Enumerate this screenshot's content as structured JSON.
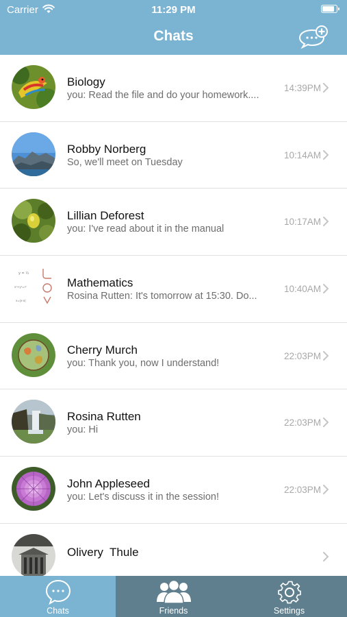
{
  "status_bar": {
    "carrier": "Carrier",
    "time": "11:29 PM",
    "battery_level": 0.9
  },
  "nav": {
    "title": "Chats",
    "new_chat_icon": "chat-plus-icon"
  },
  "chats": [
    {
      "name": "Biology",
      "preview": "you: Read the file and do your homework....",
      "time": "14:39PM",
      "avatar": "parrot-photo"
    },
    {
      "name": "Robby Norberg",
      "preview": "So, we'll meet on Tuesday",
      "time": "10:14AM",
      "avatar": "mountain-lake-photo"
    },
    {
      "name": "Lillian Deforest",
      "preview": "you: I've read about it in the manual",
      "time": "10:17AM",
      "avatar": "lemon-tree-photo"
    },
    {
      "name": "Mathematics",
      "preview": "Rosina Rutten: It's tomorrow at 15:30. Do...",
      "time": "10:40AM",
      "avatar": "math-formulas-image"
    },
    {
      "name": "Cherry Murch",
      "preview": "you: Thank you, now I understand!",
      "time": "22:03PM",
      "avatar": "map-globe-photo"
    },
    {
      "name": "Rosina Rutten",
      "preview": "you: Hi",
      "time": "22:03PM",
      "avatar": "waterfall-photo"
    },
    {
      "name": "John Appleseed",
      "preview": "you: Let's discuss it in the session!",
      "time": "22:03PM",
      "avatar": "dahlia-flower-photo"
    },
    {
      "name": "Olivery  Thule",
      "preview": "",
      "time": "",
      "avatar": "building-photo"
    }
  ],
  "tabs": [
    {
      "label": "Chats",
      "icon": "chat-bubble-icon",
      "active": true
    },
    {
      "label": "Friends",
      "icon": "people-group-icon",
      "active": false
    },
    {
      "label": "Settings",
      "icon": "gear-icon",
      "active": false
    }
  ],
  "colors": {
    "header": "#7bb4d3",
    "tab_inactive": "#5f7f8e",
    "tab_active": "#7bb4d3"
  }
}
